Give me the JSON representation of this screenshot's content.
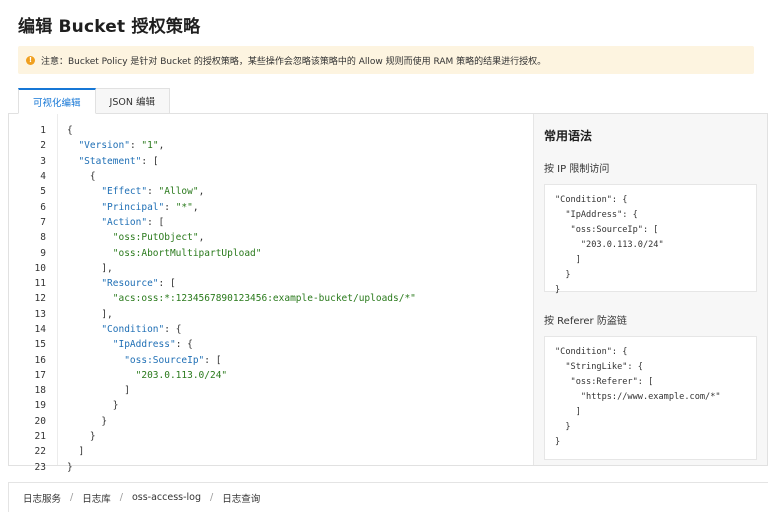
{
  "title": "编辑 Bucket 授权策略",
  "notice": {
    "text": "注意：Bucket Policy 是针对 Bucket 的授权策略，某些操作会忽略该策略中的 Allow 规则而使用 RAM 策略的结果进行授权。"
  },
  "tabs": [
    {
      "label": "可视化编辑",
      "active": true
    },
    {
      "label": "JSON 编辑",
      "active": false
    }
  ],
  "editor": {
    "line_numbers": [
      "1",
      "2",
      "3",
      "4",
      "5",
      "6",
      "7",
      "8",
      "9",
      "10",
      "11",
      "12",
      "13",
      "14",
      "15",
      "16",
      "17",
      "18",
      "19",
      "20",
      "21",
      "22",
      "23"
    ],
    "lines": [
      "{",
      "  \"Version\": \"1\",",
      "  \"Statement\": [",
      "    {",
      "      \"Effect\": \"Allow\",",
      "      \"Principal\": \"*\",",
      "      \"Action\": [",
      "        \"oss:PutObject\",",
      "        \"oss:AbortMultipartUpload\"",
      "      ],",
      "      \"Resource\": [",
      "        \"acs:oss:*:1234567890123456:example-bucket/uploads/*\"",
      "      ],",
      "      \"Condition\": {",
      "        \"IpAddress\": {",
      "          \"oss:SourceIp\": [",
      "            \"203.0.113.0/24\"",
      "          ]",
      "        }",
      "      }",
      "    }",
      "  ]",
      "}"
    ]
  },
  "sidebar": {
    "title": "常用语法",
    "section1": {
      "label": "按 IP 限制访问",
      "code": "\"Condition\": {\n  \"IpAddress\": {\n   \"oss:SourceIp\": [\n     \"203.0.113.0/24\"\n    ]\n  }\n}"
    },
    "section2": {
      "label": "按 Referer 防盗链",
      "code": "\"Condition\": {\n  \"StringLike\": {\n   \"oss:Referer\": [\n     \"https://www.example.com/*\"\n    ]\n  }\n}"
    }
  },
  "breadcrumb": {
    "items": [
      "日志服务",
      "日志库",
      "oss-access-log",
      "日志查询"
    ],
    "separator": "/"
  },
  "colors": {
    "accent": "#1677d6",
    "json_key": "#1f6fb5",
    "json_string": "#2a7a1c",
    "notice_bg": "#fdf4e0",
    "warning_icon": "#f0a020"
  }
}
